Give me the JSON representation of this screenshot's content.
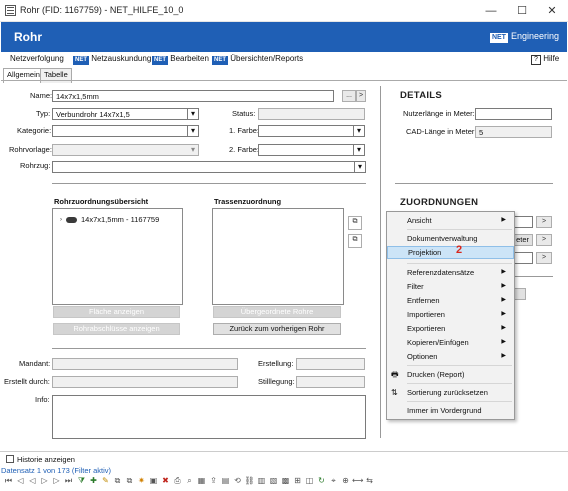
{
  "window": {
    "title": "Rohr (FID: 1167759) - NET_HILFE_10_0",
    "minimize": "—",
    "maximize": "☐",
    "close": "✕"
  },
  "header": {
    "title": "Rohr",
    "brand_logo": "NET",
    "brand_text": "Engineering"
  },
  "menubar": {
    "items": [
      {
        "label": "Netzverfolgung",
        "icon": ""
      },
      {
        "label": "Netzauskundung",
        "icon": "NET"
      },
      {
        "label": "Bearbeiten",
        "icon": "NET"
      },
      {
        "label": "Übersichten/Reports",
        "icon": "NET"
      }
    ],
    "help_label": "Hilfe",
    "help_icon": "?"
  },
  "tabs": [
    "Allgemein",
    "Tabelle"
  ],
  "form": {
    "name_label": "Name:",
    "name_value": "14x7x1,5mm",
    "typ_label": "Typ:",
    "typ_value": "Verbundrohr 14x7x1,5",
    "status_label": "Status:",
    "kategorie_label": "Kategorie:",
    "farbe1_label": "1. Farbe:",
    "rohrvorlage_label": "Rohrvorlage:",
    "farbe2_label": "2. Farbe:",
    "rohrzug_label": "Rohrzug:",
    "ellipsis": "...",
    "arrow": ">"
  },
  "rohrzuordnung": {
    "title": "Rohrzuordnungsübersicht",
    "tree_item": "14x7x1,5mm - 1167759",
    "btn_flaeche": "Fläche anzeigen",
    "btn_abschluesse": "Rohrabschlüsse anzeigen"
  },
  "trassen": {
    "title": "Trassenzuordnung",
    "btn_uebergeordnete": "Übergeordnete Rohre",
    "btn_zurueck": "Zurück zum vorherigen Rohr"
  },
  "meta": {
    "mandant_label": "Mandant:",
    "erstellt_label": "Erstellt durch:",
    "info_label": "Info:",
    "erstellung_label": "Erstellung:",
    "stilllegung_label": "Stilllegung:"
  },
  "details": {
    "title": "DETAILS",
    "nutzerlaenge_label": "Nutzerlänge in Meter:",
    "nutzerlaenge_value": "",
    "cad_label": "CAD-Länge in Meter:",
    "cad_value": "5"
  },
  "zuordnungen": {
    "title": "ZUORDNUNGEN",
    "partial_label": "eter"
  },
  "context_menu": {
    "items": [
      {
        "label": "Ansicht",
        "submenu": true
      },
      {
        "label": "Dokumentverwaltung",
        "submenu": false
      },
      {
        "label": "Projektion",
        "submenu": false,
        "highlighted": true
      },
      {
        "label": "Referenzdatensätze",
        "submenu": true
      },
      {
        "label": "Filter",
        "submenu": true
      },
      {
        "label": "Entfernen",
        "submenu": true
      },
      {
        "label": "Importieren",
        "submenu": true
      },
      {
        "label": "Exportieren",
        "submenu": true
      },
      {
        "label": "Kopieren/Einfügen",
        "submenu": true
      },
      {
        "label": "Optionen",
        "submenu": true
      },
      {
        "label": "Drucken (Report)",
        "submenu": false,
        "icon": "printer-icon"
      },
      {
        "label": "Sortierung zurücksetzen",
        "submenu": false,
        "icon": "sort-reset-icon"
      },
      {
        "label": "Immer im Vordergrund",
        "submenu": false
      }
    ],
    "annotation": "2",
    "annotation_color": "#d9261c"
  },
  "bottom": {
    "historie_label": "Historie anzeigen",
    "status_text": "Datensatz 1 von 173 (Filter aktiv)"
  },
  "colors": {
    "header_blue": "#1f5fb5",
    "highlight": "#cce4f7"
  }
}
